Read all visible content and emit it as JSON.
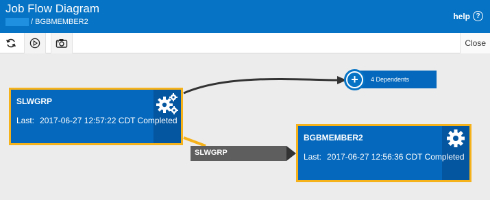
{
  "header": {
    "title": "Job Flow Diagram",
    "breadcrumb": "/ BGBMEMBER2",
    "help_label": "help",
    "help_icon": "?"
  },
  "toolbar": {
    "refresh_icon": "refresh-icon",
    "play_icon": "play-icon",
    "camera_icon": "camera-icon",
    "close_label": "Close"
  },
  "diagram": {
    "jobs": [
      {
        "name": "SLWGRP",
        "last_label": "Last:",
        "last_value": "2017-06-27 12:57:22 CDT Completed",
        "icon": "gears-icon"
      },
      {
        "name": "BGBMEMBER2",
        "last_label": "Last:",
        "last_value": "2017-06-27 12:56:36 CDT Completed",
        "icon": "gear-icon"
      }
    ],
    "dependents": {
      "label": "4 Dependents",
      "icon": "+"
    },
    "edge_label": "SLWGRP",
    "colors": {
      "node_fill": "#0568bc",
      "node_border": "#f6b21a",
      "edge_dark": "#333333",
      "edge_highlight": "#f6b21a",
      "header": "#0673c4"
    }
  }
}
